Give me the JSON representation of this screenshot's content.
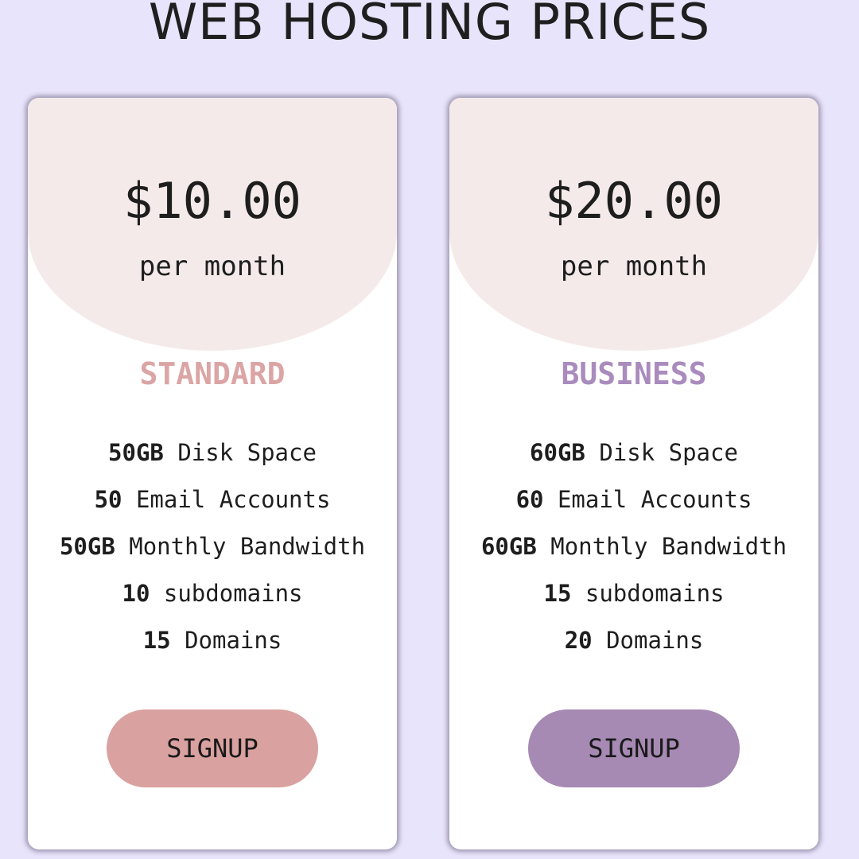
{
  "page": {
    "title": "WEB HOSTING PRICES",
    "background_color": "#e8e4fb"
  },
  "plans": [
    {
      "price": "$10.00",
      "period": "per month",
      "name": "STANDARD",
      "accent_color": "#dba5a5",
      "button_color": "#d9a19f",
      "features": [
        {
          "amount": "50GB",
          "label": "Disk Space"
        },
        {
          "amount": "50",
          "label": "Email Accounts"
        },
        {
          "amount": "50GB",
          "label": "Monthly Bandwidth"
        },
        {
          "amount": "10",
          "label": "subdomains"
        },
        {
          "amount": "15",
          "label": "Domains"
        }
      ],
      "button_label": "SIGNUP"
    },
    {
      "price": "$20.00",
      "period": "per month",
      "name": "BUSINESS",
      "accent_color": "#a98cbd",
      "button_color": "#a68ab3",
      "features": [
        {
          "amount": "60GB",
          "label": "Disk Space"
        },
        {
          "amount": "60",
          "label": "Email Accounts"
        },
        {
          "amount": "60GB",
          "label": "Monthly Bandwidth"
        },
        {
          "amount": "15",
          "label": "subdomains"
        },
        {
          "amount": "20",
          "label": "Domains"
        }
      ],
      "button_label": "SIGNUP"
    }
  ]
}
